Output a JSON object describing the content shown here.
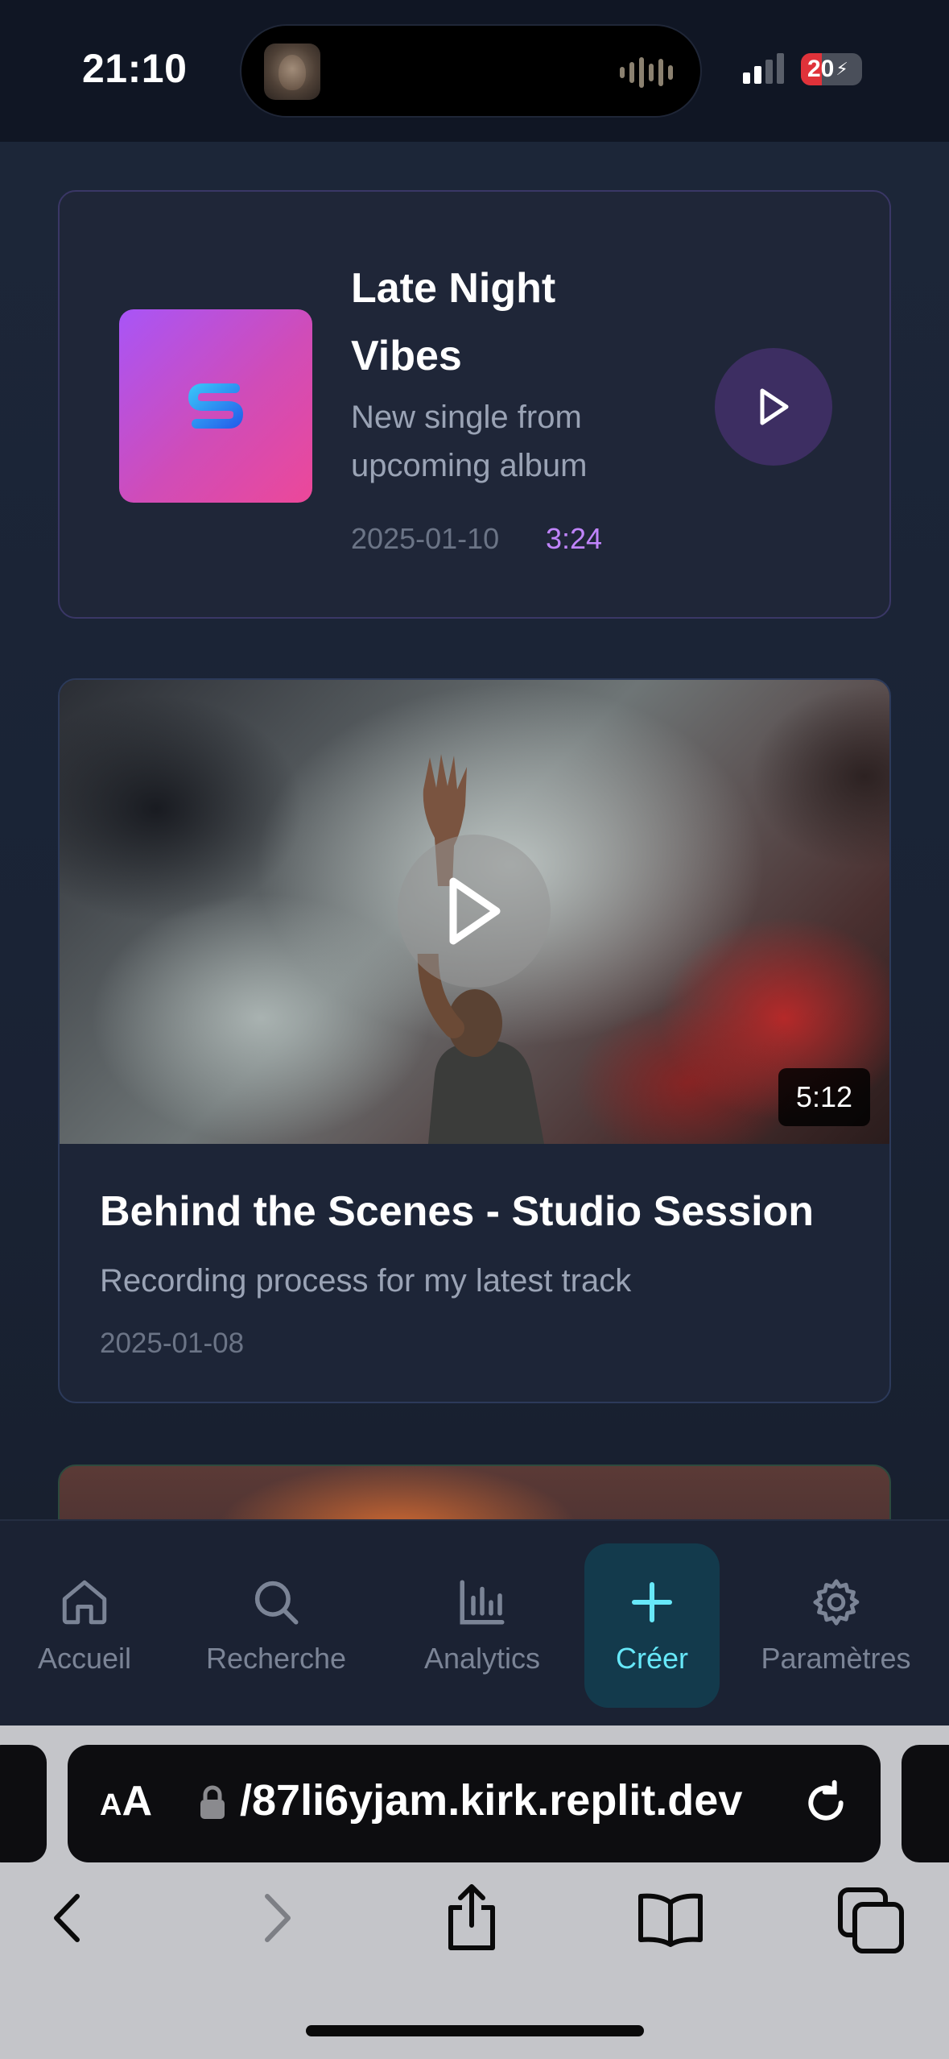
{
  "status_bar": {
    "time": "21:10",
    "battery": "20"
  },
  "track_card": {
    "title": "Late Night Vibes",
    "description": "New single from upcoming album",
    "date": "2025-01-10",
    "duration": "3:24",
    "cover_logo": "S",
    "accent_color": "#c084fc"
  },
  "video_card": {
    "title": "Behind the Scenes - Studio Session",
    "description": "Recording process for my latest track",
    "date": "2025-01-08",
    "duration": "5:12"
  },
  "bottom_nav": {
    "items": [
      {
        "label": "Accueil",
        "icon": "home-icon"
      },
      {
        "label": "Recherche",
        "icon": "search-icon"
      },
      {
        "label": "Analytics",
        "icon": "bar-chart-icon"
      },
      {
        "label": "Créer",
        "icon": "plus-icon",
        "active": true
      },
      {
        "label": "Paramètres",
        "icon": "gear-icon"
      }
    ],
    "active_color": "#67e8f9"
  },
  "browser": {
    "aa_label_small": "A",
    "aa_label_large": "A",
    "url": "/87li6yjam.kirk.replit.dev"
  }
}
